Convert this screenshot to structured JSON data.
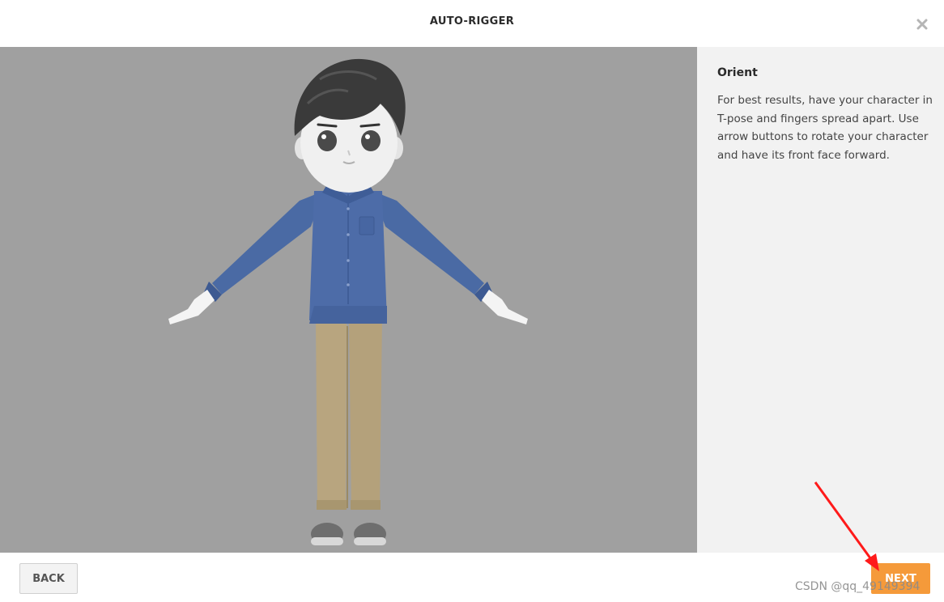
{
  "header": {
    "title": "AUTO-RIGGER",
    "close_icon": "close-icon"
  },
  "viewport": {
    "background": "#a0a0a0",
    "model_icon": "character-model"
  },
  "sidebar": {
    "heading": "Orient",
    "body": "For best results, have your character in T-pose and fingers spread apart. Use arrow buttons to rotate your character and have its front face forward."
  },
  "footer": {
    "back_label": "BACK",
    "next_label": "NEXT",
    "watermark": "CSDN @qq_49149394"
  },
  "colors": {
    "accent": "#f59a3a",
    "annotation_arrow": "#ff1a1a",
    "viewport": "#a0a0a0",
    "panel": "#f2f2f2"
  }
}
